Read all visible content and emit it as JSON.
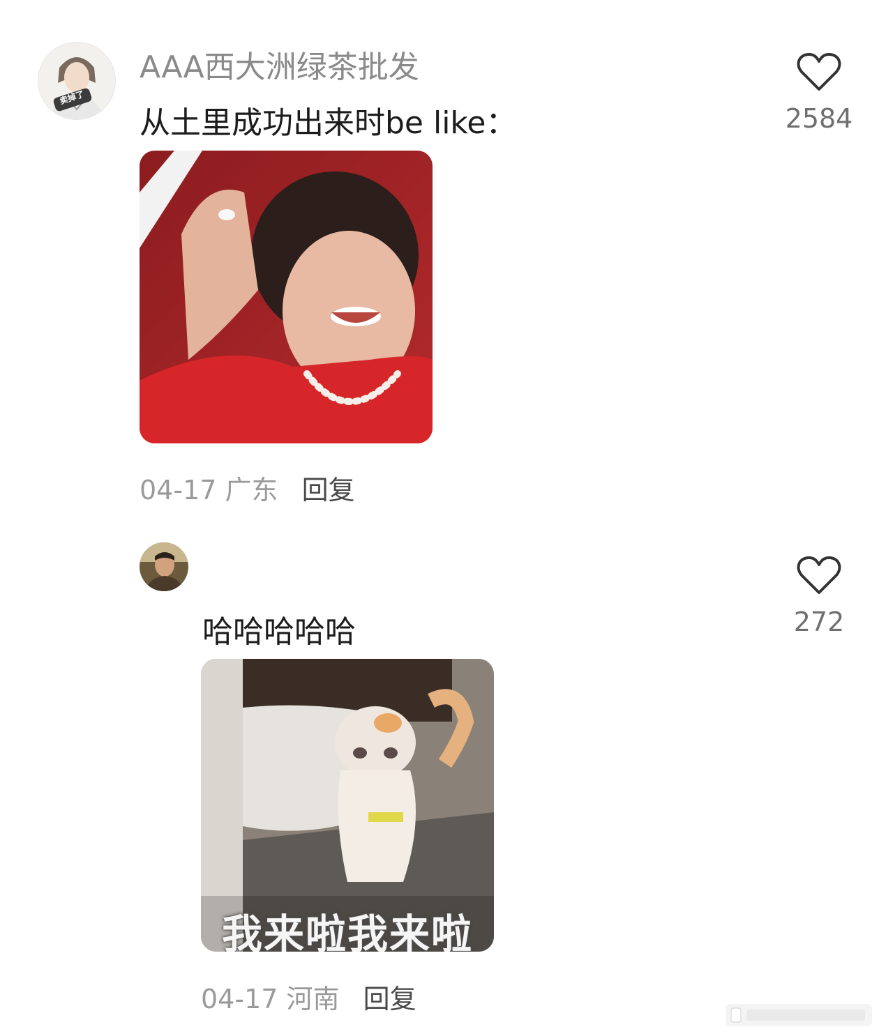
{
  "comments": [
    {
      "username": "AAA西大洲绿茶批发",
      "text": "从土里成功出来时be like：",
      "date": "04-17",
      "location": "广东",
      "reply_label": "回复",
      "likes": "2584",
      "avatar_badge": "卖掉了"
    },
    {
      "username": "",
      "text": "哈哈哈哈哈",
      "date": "04-17",
      "location": "河南",
      "reply_label": "回复",
      "likes": "272",
      "image_caption": "我来啦我来啦"
    }
  ],
  "colors": {
    "text_primary": "#1c1c1c",
    "text_secondary": "#8a8a8a",
    "reply": "#4a4a4a"
  },
  "icons": [
    "heart-outline-icon",
    "avatar"
  ]
}
